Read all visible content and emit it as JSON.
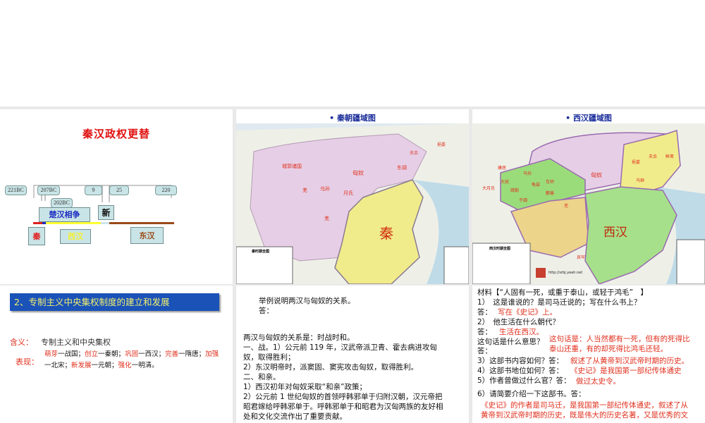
{
  "slide1": {
    "title": "秦汉政权更替",
    "bubbles": [
      "221BC",
      "207BC",
      "202BC",
      "9",
      "25",
      "220"
    ],
    "periods": {
      "chuhan": "楚汉相争",
      "xin": "新",
      "qin": "秦",
      "xihan": "西汉",
      "donghan": "东汉"
    },
    "colors": {
      "qin": "#e02020",
      "chuhan": "#1a2cc0",
      "xihan": "#ffff33",
      "donghan": "#9a4a1a",
      "title": "#e01010"
    }
  },
  "slide2": {
    "title": "秦朝疆域图",
    "labels": [
      "城郭诸国",
      "匈奴",
      "东胡",
      "夫余",
      "挹娄",
      "羌",
      "乌孙",
      "月氏",
      "羌",
      "秦"
    ],
    "legend_title": "秦时期全图"
  },
  "slide3": {
    "title": "西汉疆域图",
    "labels": [
      "匈奴",
      "鲜卑",
      "夫余",
      "挹娄",
      "乌桓",
      "康居",
      "大宛",
      "大月氏",
      "乌孙",
      "龟兹",
      "车师",
      "疏勒",
      "于阗",
      "鄯善",
      "羌",
      "西汉",
      "哀牢"
    ],
    "legend_title": "西汉时期全图",
    "watermark": "http://srbj.yeah.net"
  },
  "slide4": {
    "banner": "2、专制主义中央集权制度的建立和发展",
    "meaning_label": "含义：",
    "meaning_text": "专制主义和中央集权",
    "perf_label": "表现：",
    "perf_items": [
      {
        "k": "萌芽",
        "v": "一战国；"
      },
      {
        "k": "创立",
        "v": "一秦朝；"
      },
      {
        "k": "巩固",
        "v": "一西汉；"
      },
      {
        "k": "完善",
        "v": "一隋唐；"
      },
      {
        "k": "加强",
        "v": "一北宋；"
      },
      {
        "k": "新发展",
        "v": "一元朝；"
      },
      {
        "k": "强化",
        "v": "一明清。"
      }
    ]
  },
  "slide5": {
    "question": "举例说明两汉与匈奴的关系。",
    "answer_label": "答：",
    "lines": [
      "两汉与匈奴的关系是：时战时和。",
      "一、战。1）公元前 119 年，汉武帝派卫青、霍去病进攻匈",
      "奴，取得胜利；",
      "2）东汉明帝时，派窦固、窦宪攻击匈奴，取得胜利。",
      "二、和亲。",
      "1）西汉初年对匈奴采取“和亲”政策；",
      "2）公元前 1 世纪匈奴的首领呼韩邪单于归附汉朝，汉元帝把",
      "昭君嫁给呼韩邪单于。呼韩邪单于和昭君为汉匈两族的友好相",
      "处和文化交流作出了重要贡献。"
    ]
  },
  "slide6": {
    "material": "材料【“人固有一死，或重于泰山，或轻于鸿毛”　】",
    "q1": "1）　这是谁说的？是司马迁说的；写在什么书上？",
    "a_label": "答：",
    "a1": "写在《史记》上。",
    "q2": "2）　他生活在什么朝代？",
    "a2": "生活在西汉。",
    "q_meaning": "这句话是什么意思？",
    "a_meaning_1": "这句话是：人当然都有一死，但有的死得比",
    "a_meaning_2": "泰山还重，有的却死得比鸿毛还轻。",
    "q3": "3）这部书内容如何？答：",
    "a3": "叙述了从黄帝到汉武帝时期的历史。",
    "q4": "4）这部书地位如何？答：",
    "a4": "《史记》是我国第一部纪传体通史",
    "q5": "5）作者曾做过什么官？答：",
    "a5": "做过太史令。",
    "q6": "6）请简要介绍一下这部书。答：",
    "a6_1": "《史记》的作者是司马迁，是我国第一部纪传体通史，叙述了从",
    "a6_2": "黄帝到汉武帝时期的历史，既是伟大的历史名著，又是优秀的文"
  }
}
